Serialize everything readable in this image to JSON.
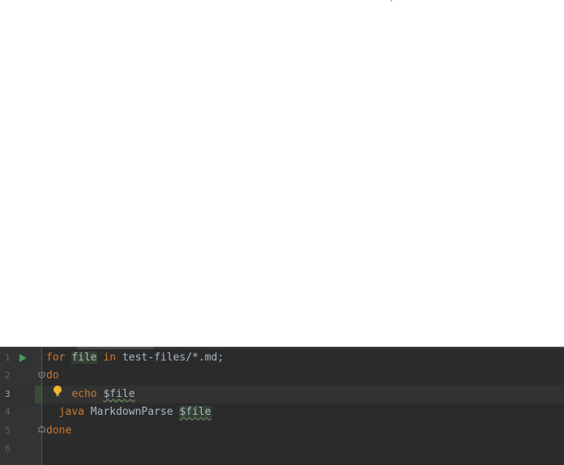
{
  "editor": {
    "line_numbers": [
      "1",
      "2",
      "3",
      "4",
      "5",
      "6"
    ],
    "current_line": 3,
    "lines": [
      {
        "indent": "",
        "tokens": [
          {
            "t": "for",
            "k": "kw"
          },
          {
            "t": " "
          },
          {
            "t": "file",
            "k": "hl"
          },
          {
            "t": " "
          },
          {
            "t": "in",
            "k": "kw"
          },
          {
            "t": " test-files/*.md;"
          }
        ]
      },
      {
        "indent": "",
        "tokens": [
          {
            "t": "do",
            "k": "kw"
          }
        ]
      },
      {
        "indent": "    ",
        "tokens": [
          {
            "t": "echo",
            "k": "kw"
          },
          {
            "t": " "
          },
          {
            "t": "$file",
            "k": "var"
          }
        ]
      },
      {
        "indent": "  ",
        "tokens": [
          {
            "t": "java",
            "k": "kw"
          },
          {
            "t": " MarkdownParse "
          },
          {
            "t": "$file",
            "k": "varhl"
          }
        ]
      },
      {
        "indent": "",
        "tokens": [
          {
            "t": "done",
            "k": "kw"
          }
        ]
      },
      {
        "indent": "",
        "tokens": []
      }
    ]
  },
  "icons": {
    "run": "run-gutter-icon",
    "fold_start": "fold-start-icon",
    "fold_end": "fold-end-icon",
    "intention": "lightbulb-icon"
  },
  "colors": {
    "editor_bg": "#2b2b2b",
    "keyword": "#cc7832",
    "text": "#a9b7c6",
    "run_green": "#499c54",
    "bulb": "#f0b431"
  }
}
